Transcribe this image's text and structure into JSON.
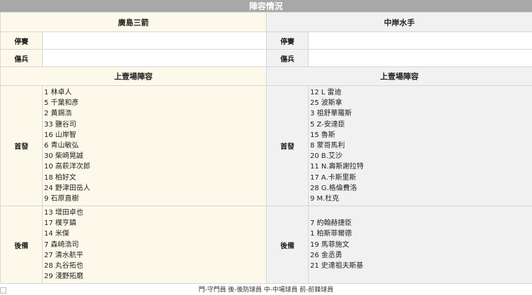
{
  "header": {
    "title": "陣容情況"
  },
  "home": {
    "team_name": "廣島三箭",
    "suspended_label": "停賽",
    "suspended_value": "",
    "injured_label": "傷兵",
    "injured_value": "",
    "last_lineup_label": "上壹場陣容",
    "starters_label": "首發",
    "starters": [
      "1 林卓人",
      "5 千葉和彥",
      "2 黃錫浩",
      "33 鹽谷司",
      "16 山岸智",
      "6 青山敏弘",
      "30 柴崎晃誠",
      "10 高萩洋次郎",
      "18 柏好文",
      "24 野津田岳人",
      "9 石原直樹"
    ],
    "subs_label": "後備",
    "subs": [
      "13 增田卓也",
      "17 樸亨鎮",
      "14 米傑",
      "7 森崎浩司",
      "27 清水航平",
      "28 丸谷拓也",
      "29 淺野拓磨"
    ]
  },
  "away": {
    "team_name": "中岸水手",
    "suspended_label": "停賽",
    "suspended_value": "",
    "injured_label": "傷兵",
    "injured_value": "",
    "last_lineup_label": "上壹場陣容",
    "starters_label": "首發",
    "starters": [
      "12 L 雷迪",
      "25 波斯拿",
      "3 祖舒華羅斯",
      "5 Z-安達臣",
      "15 魯斯",
      "8 蒙哥馬利",
      "20 B.艾沙",
      "11 N.壽斯謝拉特",
      "17 A.卡斯里斯",
      "28 G.格倫費洛",
      "9 M.杜克"
    ],
    "subs_label": "後備",
    "subs": [
      "7 約翰赫捷臣",
      "1 柏斯菲爾德",
      "19 馬菲施文",
      "26 金丞勇",
      "21 史達祖夫斯基"
    ]
  },
  "legend": {
    "text": "門-守門員 後-後防球員 中-中場球員 前-前鋒球員"
  }
}
